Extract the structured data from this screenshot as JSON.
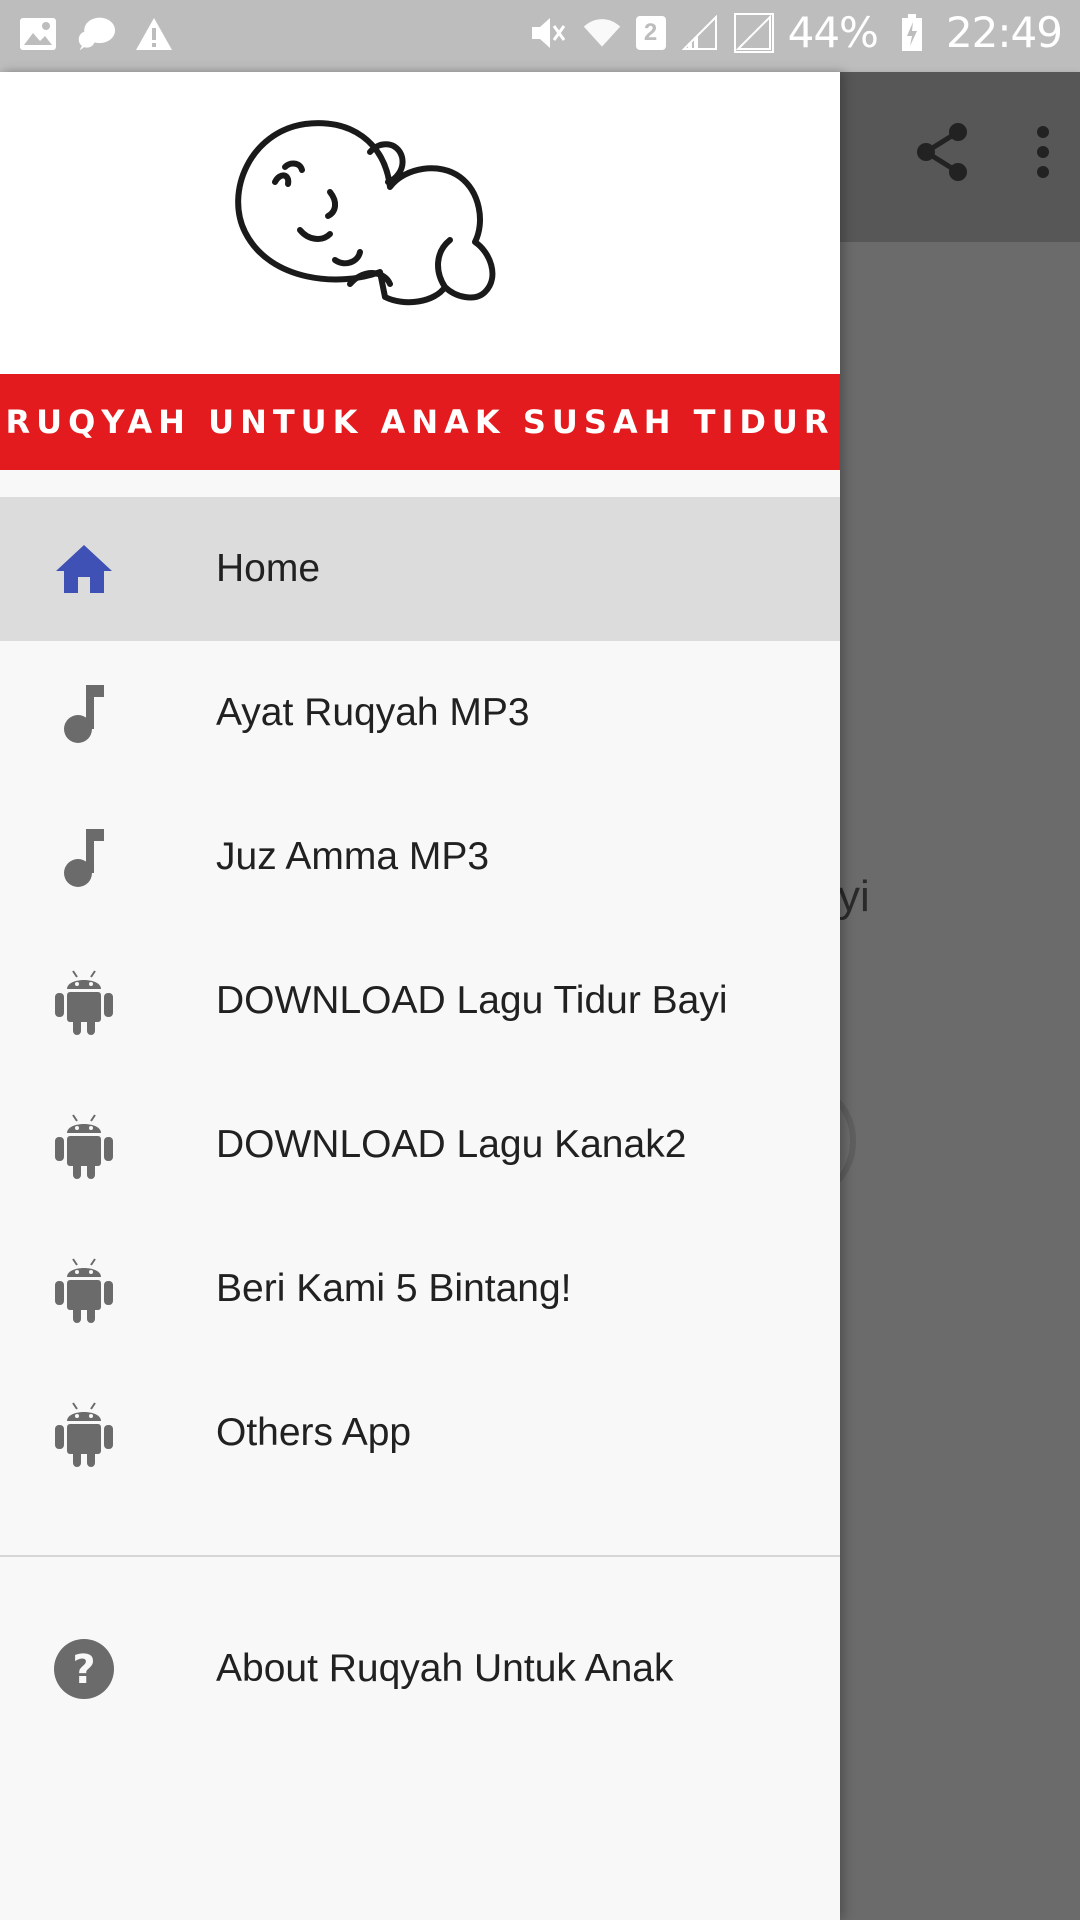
{
  "status_bar": {
    "battery": "44%",
    "time": "22:49",
    "sim_badge": "2",
    "left_icons": [
      "image-icon",
      "chat-icon",
      "warning-icon"
    ],
    "right_icons": [
      "mute-icon",
      "wifi-icon",
      "signal-icon",
      "signal-icon",
      "battery-charging-icon"
    ]
  },
  "app_bar": {
    "actions": [
      "share-icon",
      "more-vert-icon"
    ]
  },
  "background": {
    "partial_text": "yi"
  },
  "drawer": {
    "banner_title": "RUQYAH UNTUK ANAK SUSAH TIDUR",
    "items": [
      {
        "label": "Home",
        "icon": "home-icon",
        "active": true
      },
      {
        "label": "Ayat Ruqyah MP3",
        "icon": "music-note-icon"
      },
      {
        "label": "Juz Amma MP3",
        "icon": "music-note-icon"
      },
      {
        "label": "DOWNLOAD Lagu Tidur Bayi",
        "icon": "android-icon"
      },
      {
        "label": "DOWNLOAD Lagu Kanak2",
        "icon": "android-icon"
      },
      {
        "label": "Beri Kami 5 Bintang!",
        "icon": "android-icon"
      },
      {
        "label": "Others App",
        "icon": "android-icon"
      }
    ],
    "footer_item": {
      "label": "About Ruqyah Untuk Anak",
      "icon": "help-icon"
    }
  },
  "colors": {
    "banner": "#e31b1f",
    "home_icon": "#3f51b5",
    "menu_icon": "#6b6b6b",
    "active_row": "#dcdcdc"
  }
}
